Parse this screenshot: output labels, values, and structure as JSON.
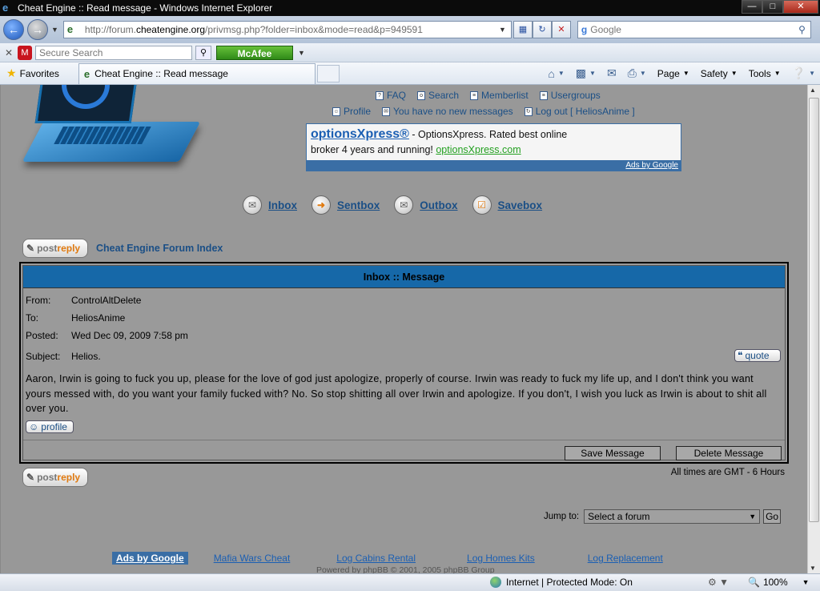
{
  "window": {
    "title": "Cheat Engine :: Read message - Windows Internet Explorer"
  },
  "address_bar": {
    "url_prefix": "http://forum.",
    "url_domain": "cheatengine.org",
    "url_suffix": "/privmsg.php?folder=inbox&mode=read&p=949591"
  },
  "search_bar": {
    "placeholder": "Google"
  },
  "toolbar": {
    "secure_search_placeholder": "Secure Search",
    "mcafee_label": "McAfee"
  },
  "favorites_bar": {
    "favorites_label": "Favorites",
    "tab_title": "Cheat Engine :: Read message",
    "commands": [
      "Page",
      "Safety",
      "Tools"
    ]
  },
  "forum_header": {
    "links_row1": [
      "FAQ",
      "Search",
      "Memberlist",
      "Usergroups"
    ],
    "links_row2": [
      "Profile",
      "You have no new messages",
      "Log out [ HeliosAnime ]"
    ]
  },
  "ad": {
    "title": "optionsXpress®",
    "text_line1": " - OptionsXpress. Rated best online",
    "text_line2": "broker 4 years and running! ",
    "url": "optionsXpress.com",
    "footer": "Ads by Google"
  },
  "folders": [
    "Inbox",
    "Sentbox",
    "Outbox",
    "Savebox"
  ],
  "post_reply": {
    "part1": "post",
    "part2": "reply"
  },
  "forum_index": "Cheat Engine Forum Index",
  "message": {
    "header": "Inbox :: Message",
    "from_label": "From:",
    "from": "ControlAltDelete",
    "to_label": "To:",
    "to": "HeliosAnime",
    "posted_label": "Posted:",
    "posted": "Wed Dec 09, 2009 7:58 pm",
    "subject_label": "Subject:",
    "subject": "Helios.",
    "quote_label": "quote",
    "body": "Aaron, Irwin is going to fuck you up, please for the love of god just apologize, properly of course. Irwin was ready to fuck my life up, and I don't think you want yours messed with, do you want your family fucked with? No. So stop shitting all over Irwin and apologize. If you don't, I wish you luck as Irwin is about to shit all over you.",
    "profile_label": "profile",
    "save_button": "Save Message",
    "delete_button": "Delete Message"
  },
  "times_note": "All times are GMT - 6 Hours",
  "jump": {
    "label": "Jump to:",
    "selected": "Select a forum",
    "go": "Go"
  },
  "bottom_ads": {
    "label": "Ads by Google",
    "links": [
      "Mafia Wars Cheat",
      "Log Cabins Rental",
      "Log Homes Kits",
      "Log Replacement"
    ]
  },
  "powered_by": "Powered by phpBB © 2001, 2005 phpBB Group",
  "status_bar": {
    "zone": "Internet | Protected Mode: On",
    "zoom": "100%"
  }
}
